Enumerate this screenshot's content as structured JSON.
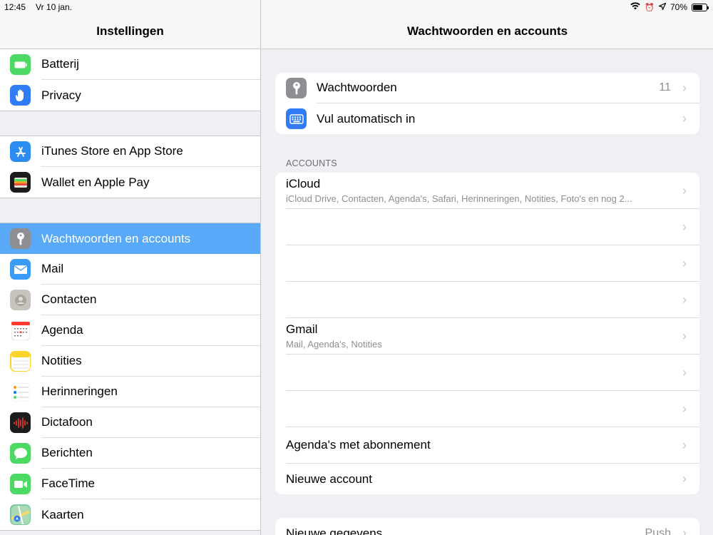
{
  "status_bar": {
    "time": "12:45",
    "date": "Vr 10 jan.",
    "battery_percent": "70%",
    "battery_level": 0.7
  },
  "left_panel": {
    "title": "Instellingen",
    "groups": [
      [
        {
          "label": "Batterij",
          "icon": "battery-icon",
          "color": "#4cd964"
        },
        {
          "label": "Privacy",
          "icon": "hand-icon",
          "color": "#2f7cf6"
        }
      ],
      [
        {
          "label": "iTunes Store en App Store",
          "icon": "app-store-icon",
          "color": "#2d8cf0"
        },
        {
          "label": "Wallet en Apple Pay",
          "icon": "wallet-icon",
          "color": "#1c1c1e"
        }
      ],
      [
        {
          "label": "Wachtwoorden en accounts",
          "icon": "key-icon",
          "color": "#8e8e93",
          "selected": true
        },
        {
          "label": "Mail",
          "icon": "mail-icon",
          "color": "#3a9bf7"
        },
        {
          "label": "Contacten",
          "icon": "contacts-icon",
          "color": "#c7c4bd"
        },
        {
          "label": "Agenda",
          "icon": "calendar-icon",
          "color": "#ffffff"
        },
        {
          "label": "Notities",
          "icon": "notes-icon",
          "color": "#ffd42a"
        },
        {
          "label": "Herinneringen",
          "icon": "reminders-icon",
          "color": "#ffffff"
        },
        {
          "label": "Dictafoon",
          "icon": "voice-memo-icon",
          "color": "#1c1c1e"
        },
        {
          "label": "Berichten",
          "icon": "messages-icon",
          "color": "#4cd964"
        },
        {
          "label": "FaceTime",
          "icon": "facetime-icon",
          "color": "#4cd964"
        },
        {
          "label": "Kaarten",
          "icon": "maps-icon",
          "color": "#7ec8a0"
        }
      ]
    ]
  },
  "right_panel": {
    "title": "Wachtwoorden en accounts",
    "top_group": [
      {
        "label": "Wachtwoorden",
        "value": "11",
        "icon": "key-icon",
        "color": "#8e8e93"
      },
      {
        "label": "Vul automatisch in",
        "value": "",
        "icon": "keyboard-icon",
        "color": "#2f7cf6"
      }
    ],
    "accounts_header": "ACCOUNTS",
    "accounts": [
      {
        "title": "iCloud",
        "subtitle": "iCloud Drive, Contacten, Agenda's, Safari, Herinneringen, Notities, Foto's en nog 2..."
      },
      {
        "title": "",
        "subtitle": ""
      },
      {
        "title": "",
        "subtitle": ""
      },
      {
        "title": "",
        "subtitle": ""
      },
      {
        "title": "Gmail",
        "subtitle": "Mail, Agenda's, Notities"
      },
      {
        "title": "",
        "subtitle": ""
      },
      {
        "title": "",
        "subtitle": ""
      },
      {
        "title": "Agenda's met abonnement",
        "subtitle": ""
      },
      {
        "title": "Nieuwe account",
        "subtitle": ""
      }
    ],
    "fetch": {
      "label": "Nieuwe gegevens",
      "value": "Push"
    }
  }
}
